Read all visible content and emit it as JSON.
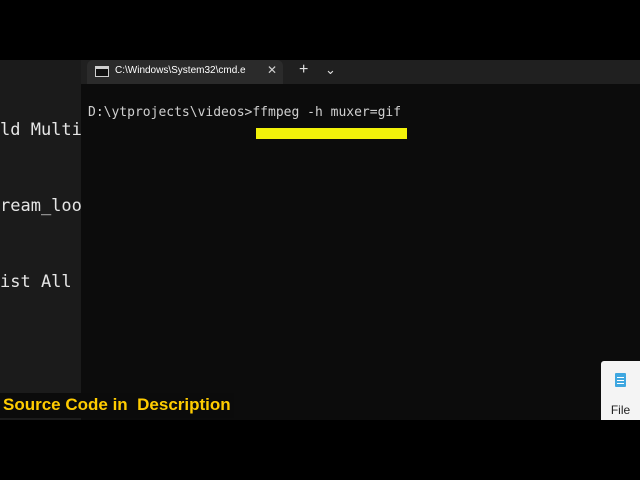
{
  "background_editor": {
    "lines": [
      "ld Multip",
      "ream_loop",
      "ist All C"
    ]
  },
  "terminal": {
    "tab_title": "C:\\Windows\\System32\\cmd.e",
    "tab_close": "✕",
    "new_tab": "+",
    "dropdown": "⌄",
    "prompt_line": "D:\\ytprojects\\videos>ffmpeg -h muxer=gif"
  },
  "taskbar": {
    "file_label": "File"
  },
  "caption": "Source Code in  Description",
  "colors": {
    "highlight": "#f2f20a",
    "caption_text": "#ffcc00",
    "terminal_bg": "#0c0c0c"
  }
}
